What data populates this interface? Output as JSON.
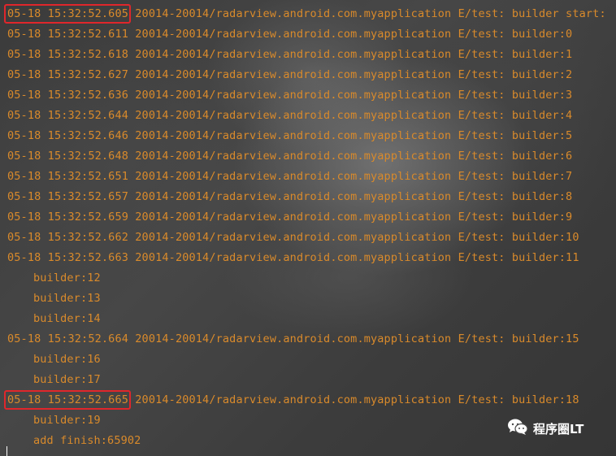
{
  "log": {
    "lines": [
      {
        "ts": "05-18 15:32:52.605",
        "rest": " 20014-20014/radarview.android.com.myapplication E/test: builder start:"
      },
      {
        "ts": "05-18 15:32:52.611",
        "rest": " 20014-20014/radarview.android.com.myapplication E/test: builder:0"
      },
      {
        "ts": "05-18 15:32:52.618",
        "rest": " 20014-20014/radarview.android.com.myapplication E/test: builder:1"
      },
      {
        "ts": "05-18 15:32:52.627",
        "rest": " 20014-20014/radarview.android.com.myapplication E/test: builder:2"
      },
      {
        "ts": "05-18 15:32:52.636",
        "rest": " 20014-20014/radarview.android.com.myapplication E/test: builder:3"
      },
      {
        "ts": "05-18 15:32:52.644",
        "rest": " 20014-20014/radarview.android.com.myapplication E/test: builder:4"
      },
      {
        "ts": "05-18 15:32:52.646",
        "rest": " 20014-20014/radarview.android.com.myapplication E/test: builder:5"
      },
      {
        "ts": "05-18 15:32:52.648",
        "rest": " 20014-20014/radarview.android.com.myapplication E/test: builder:6"
      },
      {
        "ts": "05-18 15:32:52.651",
        "rest": " 20014-20014/radarview.android.com.myapplication E/test: builder:7"
      },
      {
        "ts": "05-18 15:32:52.657",
        "rest": " 20014-20014/radarview.android.com.myapplication E/test: builder:8"
      },
      {
        "ts": "05-18 15:32:52.659",
        "rest": " 20014-20014/radarview.android.com.myapplication E/test: builder:9"
      },
      {
        "ts": "05-18 15:32:52.662",
        "rest": " 20014-20014/radarview.android.com.myapplication E/test: builder:10"
      },
      {
        "ts": "05-18 15:32:52.663",
        "rest": " 20014-20014/radarview.android.com.myapplication E/test: builder:11"
      },
      {
        "ts": "",
        "rest": "builder:12"
      },
      {
        "ts": "",
        "rest": "builder:13"
      },
      {
        "ts": "",
        "rest": "builder:14"
      },
      {
        "ts": "05-18 15:32:52.664",
        "rest": " 20014-20014/radarview.android.com.myapplication E/test: builder:15"
      },
      {
        "ts": "",
        "rest": "builder:16"
      },
      {
        "ts": "",
        "rest": "builder:17"
      },
      {
        "ts": "05-18 15:32:52.665",
        "rest": " 20014-20014/radarview.android.com.myapplication E/test: builder:18"
      },
      {
        "ts": "",
        "rest": "builder:19"
      },
      {
        "ts": "",
        "rest": "add finish:65902"
      }
    ]
  },
  "watermark": {
    "icon": "wechat-icon",
    "label": "程序圈LT"
  },
  "colors": {
    "log_text": "#d98a2b",
    "highlight_box": "#e0262b"
  }
}
